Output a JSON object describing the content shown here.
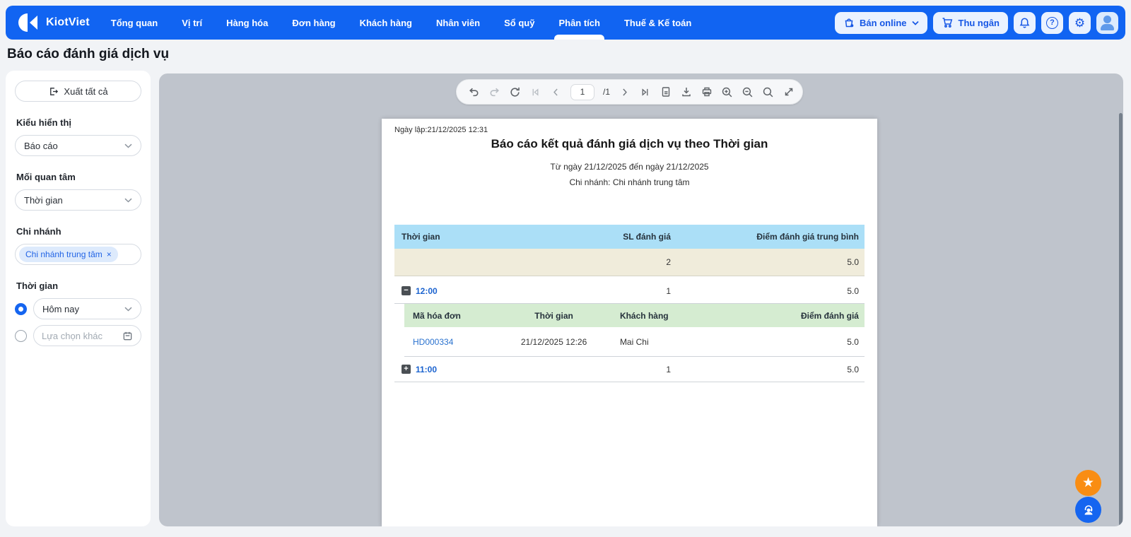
{
  "app": {
    "brand": "KiotViet"
  },
  "nav": {
    "items": [
      {
        "label": "Tổng quan"
      },
      {
        "label": "Vị trí"
      },
      {
        "label": "Hàng hóa"
      },
      {
        "label": "Đơn hàng"
      },
      {
        "label": "Khách hàng"
      },
      {
        "label": "Nhân viên"
      },
      {
        "label": "Sổ quỹ"
      },
      {
        "label": "Phân tích"
      },
      {
        "label": "Thuế & Kế toán"
      }
    ],
    "active_item": "Phân tích",
    "ban_online_label": "Bán online",
    "thu_ngan_label": "Thu ngân"
  },
  "page_title": "Báo cáo đánh giá dịch vụ",
  "sidebar": {
    "export_label": "Xuất tất cả",
    "display_type": {
      "label": "Kiểu hiển thị",
      "value": "Báo cáo"
    },
    "concern": {
      "label": "Mối quan tâm",
      "value": "Thời gian"
    },
    "branch": {
      "label": "Chi nhánh",
      "tag": "Chi nhánh trung tâm",
      "tag_close": "×"
    },
    "time": {
      "label": "Thời gian",
      "selected_option": "Hôm nay",
      "other_placeholder": "Lựa chọn khác"
    }
  },
  "pdf_toolbar": {
    "page_current": "1",
    "page_total_label": "/1"
  },
  "report": {
    "created_label": "Ngày lập:21/12/2025 12:31",
    "title": "Báo cáo kết quả đánh giá dịch vụ theo Thời gian",
    "date_range": "Từ ngày 21/12/2025 đến ngày 21/12/2025",
    "branch_line": "Chi nhánh: Chi nhánh trung tâm",
    "table": {
      "headers": [
        "Thời gian",
        "SL đánh giá",
        "Điểm đánh giá trung bình"
      ],
      "summary": {
        "sl": "2",
        "score": "5.0"
      },
      "groups": [
        {
          "time": "12:00",
          "sl": "1",
          "score": "5.0",
          "toggle": "−",
          "expanded": true
        },
        {
          "time": "11:00",
          "sl": "1",
          "score": "5.0",
          "toggle": "+",
          "expanded": false
        }
      ],
      "detail": {
        "headers": [
          "Mã hóa đơn",
          "Thời gian",
          "Khách hàng",
          "Điểm đánh giá"
        ],
        "rows": [
          {
            "invoice": "HD000334",
            "time": "21/12/2025 12:26",
            "customer": "Mai Chi",
            "score": "5.0"
          }
        ]
      }
    }
  },
  "icons": {
    "star": "★",
    "question": "?",
    "gear": "⚙"
  },
  "colors": {
    "nav_blue": "#1164f2",
    "accent_blue": "#1565f0",
    "table_header_blue": "#abdff7",
    "summary_beige": "#f0ecdb",
    "detail_header_green": "#d5ecd1",
    "fab_orange": "#f98d13",
    "link_blue": "#2a72cf"
  }
}
